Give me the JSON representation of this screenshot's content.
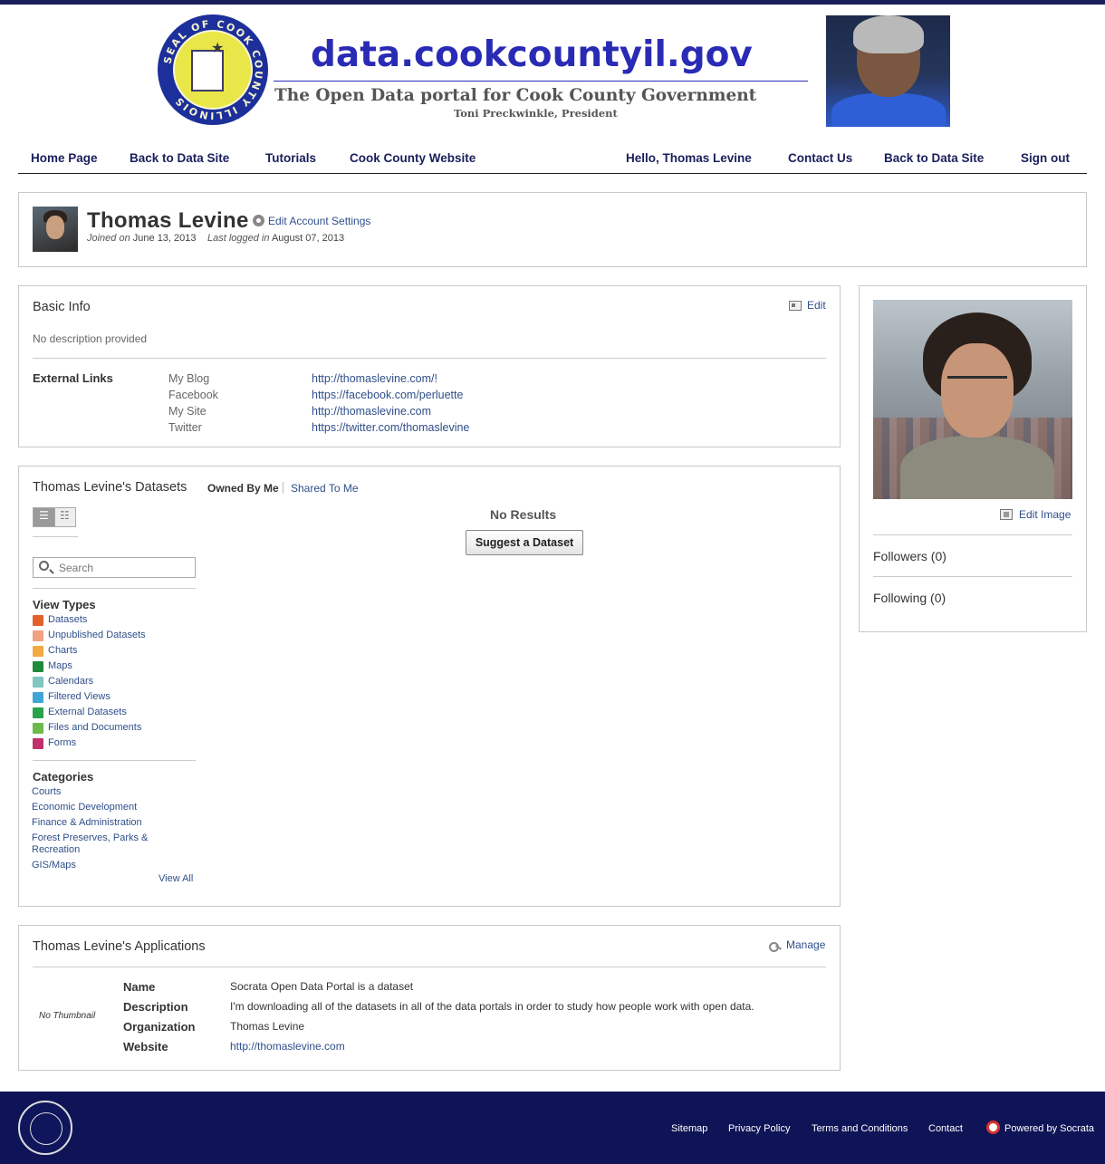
{
  "banner": {
    "site_title": "data.cookcountyil.gov",
    "subtitle": "The Open Data portal for Cook County Government",
    "president": "Toni Preckwinkle, President",
    "seal_text": "SEAL OF COOK COUNTY ILLINOIS"
  },
  "nav": {
    "left": [
      "Home Page",
      "Back to Data Site",
      "Tutorials",
      "Cook County Website"
    ],
    "right": [
      "Hello, Thomas Levine",
      "Contact Us",
      "Back to Data Site",
      "Sign out"
    ]
  },
  "profile": {
    "name": "Thomas Levine",
    "edit_account": "Edit Account Settings",
    "joined_label": "Joined on",
    "joined_date": "June 13, 2013",
    "last_logged_label": "Last logged in",
    "last_logged_date": "August 07, 2013"
  },
  "basic_info": {
    "title": "Basic Info",
    "edit": "Edit",
    "description": "No description provided",
    "external_links_label": "External Links",
    "links": [
      {
        "name": "My Blog",
        "url": "http://thomaslevine.com/!"
      },
      {
        "name": "Facebook",
        "url": "https://facebook.com/perluette"
      },
      {
        "name": "My Site",
        "url": "http://thomaslevine.com"
      },
      {
        "name": "Twitter",
        "url": "https://twitter.com/thomaslevine"
      }
    ]
  },
  "datasets": {
    "title": "Thomas Levine's Datasets",
    "tab_owned": "Owned By Me",
    "tab_shared": "Shared To Me",
    "search_placeholder": "Search",
    "view_types_title": "View Types",
    "view_types": [
      {
        "label": "Datasets",
        "color": "#e0622a"
      },
      {
        "label": "Unpublished Datasets",
        "color": "#f0a283"
      },
      {
        "label": "Charts",
        "color": "#f3a941"
      },
      {
        "label": "Maps",
        "color": "#1f8a3b"
      },
      {
        "label": "Calendars",
        "color": "#7fc6c0"
      },
      {
        "label": "Filtered Views",
        "color": "#3fa6d6"
      },
      {
        "label": "External Datasets",
        "color": "#2aa24a"
      },
      {
        "label": "Files and Documents",
        "color": "#6cbb4a"
      },
      {
        "label": "Forms",
        "color": "#c0306a"
      }
    ],
    "categories_title": "Categories",
    "categories": [
      "Courts",
      "Economic Development",
      "Finance & Administration",
      "Forest Preserves, Parks & Recreation",
      "GIS/Maps"
    ],
    "view_all": "View All",
    "no_results": "No Results",
    "suggest_button": "Suggest a Dataset"
  },
  "applications": {
    "title": "Thomas Levine's Applications",
    "manage": "Manage",
    "no_thumbnail": "No Thumbnail",
    "fields": [
      {
        "key": "Name",
        "value": "Socrata Open Data Portal is a dataset"
      },
      {
        "key": "Description",
        "value": "I'm downloading all of the datasets in all of the data portals in order to study how people work with open data."
      },
      {
        "key": "Organization",
        "value": "Thomas Levine"
      },
      {
        "key": "Website",
        "value": "http://thomaslevine.com"
      }
    ]
  },
  "sidebar": {
    "edit_image": "Edit Image",
    "followers": "Followers (0)",
    "following": "Following (0)"
  },
  "footer": {
    "links": [
      "Sitemap",
      "Privacy Policy",
      "Terms and Conditions",
      "Contact"
    ],
    "powered_by": "Powered by Socrata"
  }
}
